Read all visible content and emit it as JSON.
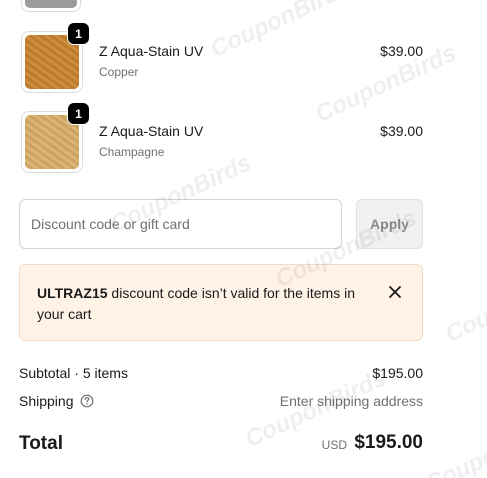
{
  "cart": {
    "items": [
      {
        "name": "Z Aqua-Stain UV",
        "variant": "Copper",
        "price": "$39.00",
        "quantity": "1",
        "swatch_color": "#c8832e"
      },
      {
        "name": "Z Aqua-Stain UV",
        "variant": "Champagne",
        "price": "$39.00",
        "quantity": "1",
        "swatch_color": "#d8ac66"
      }
    ],
    "cut_item_swatch_color": "#9b9b9b"
  },
  "discount": {
    "placeholder": "Discount code or gift card",
    "value": "",
    "apply_label": "Apply"
  },
  "error": {
    "code": "ULTRAZ15",
    "message": " discount code isn’t valid for the items in your cart"
  },
  "summary": {
    "subtotal_label": "Subtotal · 5 items",
    "subtotal_value": "$195.00",
    "shipping_label": "Shipping",
    "shipping_value": "Enter shipping address",
    "total_label": "Total",
    "total_currency": "USD",
    "total_value": "$195.00"
  },
  "watermark": {
    "text": "CouponBirds"
  },
  "colors": {
    "error_bg": "#fff3e8",
    "apply_bg": "#f1f1f1",
    "badge_bg": "#000000"
  }
}
